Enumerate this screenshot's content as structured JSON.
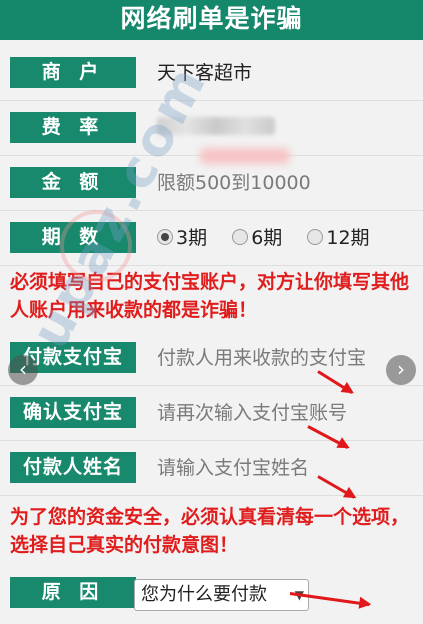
{
  "header": {
    "title": "网络刷单是诈骗"
  },
  "rows": {
    "merchant": {
      "label": "商 户",
      "value": "天下客超市"
    },
    "rate": {
      "label": "费 率"
    },
    "amount": {
      "label": "金 额",
      "value": "限额500到10000"
    },
    "period": {
      "label": "期 数",
      "options": [
        "3期",
        "6期",
        "12期"
      ],
      "selected": "3期"
    },
    "payer_alipay": {
      "label": "付款支付宝",
      "placeholder": "付款人用来收款的支付宝"
    },
    "confirm_alipay": {
      "label": "确认支付宝",
      "placeholder": "请再次输入支付宝账号"
    },
    "payer_name": {
      "label": "付款人姓名",
      "placeholder": "请输入支付宝姓名"
    },
    "reason": {
      "label": "原 因",
      "selected": "您为什么要付款"
    }
  },
  "warnings": {
    "first": "必须填写自己的支付宝账户，对方让你填写其他人账户用来收款的都是诈骗！",
    "second": "为了您的资金安全，必须认真看清每一个选项，选择自己真实的付款意图！"
  },
  "watermark": {
    "text": "upaz.com"
  },
  "colors": {
    "header": "#15876b",
    "label_bg": "#18896d",
    "warning": "#e01c1c"
  }
}
